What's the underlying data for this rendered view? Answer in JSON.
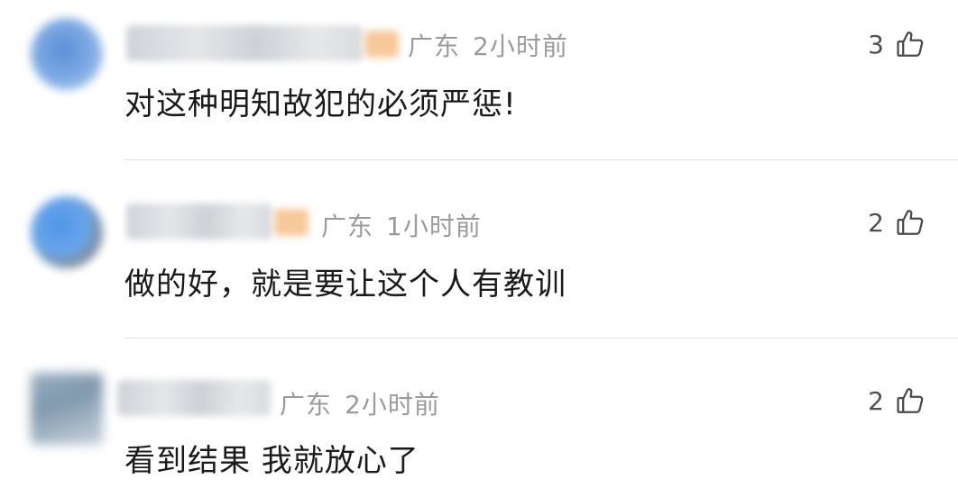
{
  "comments": [
    {
      "location": "广东",
      "time": "2小时前",
      "likes": "3",
      "text": "对这种明知故犯的必须严惩!",
      "avatar_colors": [
        "#5a8fd8",
        "#a9c7ee"
      ]
    },
    {
      "location": "广东",
      "time": "1小时前",
      "likes": "2",
      "text": "做的好，就是要让这个人有教训",
      "avatar_colors": [
        "#4f93e6",
        "#8f7a5c"
      ]
    },
    {
      "location": "广东",
      "time": "2小时前",
      "likes": "2",
      "text": "看到结果 我就放心了",
      "avatar_colors": [
        "#7f98ad",
        "#c9d3dc"
      ]
    }
  ],
  "icons": {
    "like": "thumbs-up-icon"
  }
}
